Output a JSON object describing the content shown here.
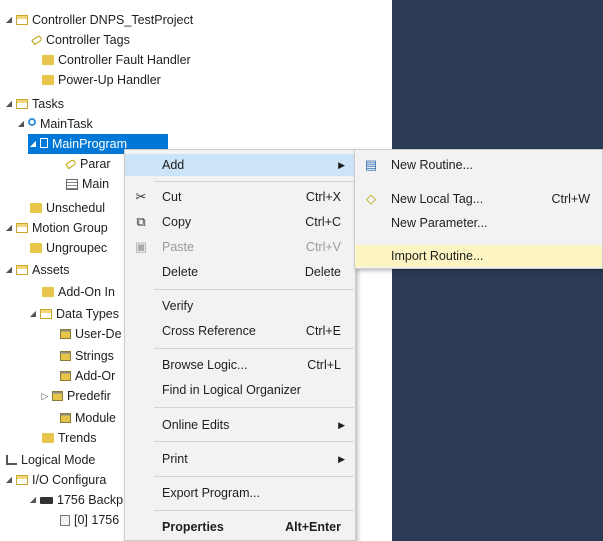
{
  "tree": {
    "controller": "Controller DNPS_TestProject",
    "controller_tags": "Controller Tags",
    "controller_fault_handler": "Controller Fault Handler",
    "power_up_handler": "Power-Up Handler",
    "tasks": "Tasks",
    "main_task": "MainTask",
    "main_program": "MainProgram",
    "parameters": "Parar",
    "main_routine": "Main",
    "unscheduled": "Unschedul",
    "motion_groups": "Motion Group",
    "ungrouped": "Ungroupec",
    "assets": "Assets",
    "add_on_instructions": "Add-On In",
    "data_types": "Data Types",
    "user_defined": "User-De",
    "strings": "Strings",
    "add_on_defined": "Add-Or",
    "predefined": "Predefir",
    "module_defined": "Module",
    "trends": "Trends",
    "logical_model": "Logical Mode",
    "io_configuration": "I/O Configura",
    "backplane": "1756 Backp",
    "slot0": "[0] 1756"
  },
  "context_menu": {
    "add": "Add",
    "cut": "Cut",
    "cut_sc": "Ctrl+X",
    "copy": "Copy",
    "copy_sc": "Ctrl+C",
    "paste": "Paste",
    "paste_sc": "Ctrl+V",
    "delete": "Delete",
    "delete_sc": "Delete",
    "verify": "Verify",
    "cross_reference": "Cross Reference",
    "cross_reference_sc": "Ctrl+E",
    "browse_logic": "Browse Logic...",
    "browse_logic_sc": "Ctrl+L",
    "find_logical": "Find in Logical Organizer",
    "online_edits": "Online Edits",
    "print": "Print",
    "export_program": "Export Program...",
    "properties": "Properties",
    "properties_sc": "Alt+Enter"
  },
  "submenu": {
    "new_routine": "New Routine...",
    "new_local_tag": "New Local Tag...",
    "new_local_tag_sc": "Ctrl+W",
    "new_parameter": "New Parameter...",
    "import_routine": "Import Routine..."
  },
  "colors": {
    "selection": "#0078d7",
    "menu_hover": "#cce4f7",
    "submenu_hover": "#fcf4c2",
    "dark_panel": "#2b3a55"
  }
}
